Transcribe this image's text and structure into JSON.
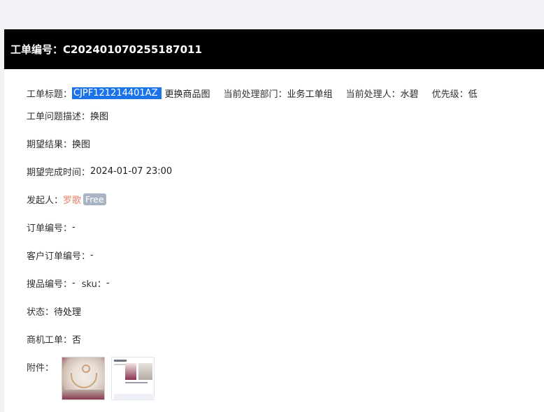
{
  "ticket": {
    "header_title": "工单编号：C202401070255187011",
    "title_label": "工单标题：",
    "title_selected": "CJPF121214401AZ",
    "title_rest": "更换商品图",
    "dept_label": "当前处理部门：",
    "dept_value": "业务工单组",
    "handler_label": "当前处理人：",
    "handler_value": "水碧",
    "priority_label": "优先级：",
    "priority_value": "低",
    "desc_label": "工单问题描述：",
    "desc_value": "换图",
    "expect_label": "期望结果：",
    "expect_value": "换图",
    "due_label": "期望完成时间：",
    "due_value": "2024-01-07 23:00",
    "initiator_label": "发起人：",
    "initiator_value": "罗歌",
    "initiator_badge": "Free",
    "order_label": "订单编号：",
    "order_value": "-",
    "cust_order_label": "客户订单编号：",
    "cust_order_value": "-",
    "search_label": "搜品编号：",
    "search_value": "-",
    "sku_label": "sku：",
    "sku_value": "-",
    "status_label": "状态：",
    "status_value": "待处理",
    "biz_label": "商机工单：",
    "biz_value": "否",
    "attach_label": "附件："
  },
  "colors": {
    "header_bg": "#000000",
    "selection": "#1a73e8",
    "initiator": "#e8806a",
    "badge_bg": "#a9b4c2"
  }
}
